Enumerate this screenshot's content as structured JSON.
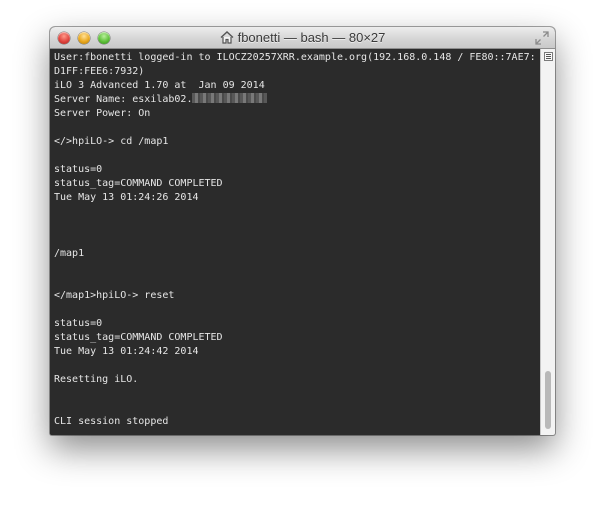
{
  "window": {
    "title": "fbonetti — bash — 80×27"
  },
  "terminal": {
    "line_1": "User:fbonetti logged-in to ILOCZ20257XRR.example.org(192.168.0.148 / FE80::7AE7:",
    "line_2": "D1FF:FEE6:7932)",
    "line_3": "iLO 3 Advanced 1.70 at  Jan 09 2014",
    "line_4": "Server Name: esxilab02.",
    "line_5": "Server Power: On",
    "line_7": "</>hpiLO-> cd /map1",
    "line_9": "status=0",
    "line_10": "status_tag=COMMAND COMPLETED",
    "line_11": "Tue May 13 01:24:26 2014",
    "line_15": "/map1",
    "line_18": "</map1>hpiLO-> reset",
    "line_20": "status=0",
    "line_21": "status_tag=COMMAND COMPLETED",
    "line_22": "Tue May 13 01:24:42 2014",
    "line_24": "Resetting iLO.",
    "line_27": "CLI session stopped"
  },
  "colors": {
    "terminal_bg": "#2b2b2b",
    "terminal_fg": "#e6e6e6"
  },
  "icons": {
    "title_icon": "home-icon",
    "fullscreen": "fullscreen-icon"
  }
}
